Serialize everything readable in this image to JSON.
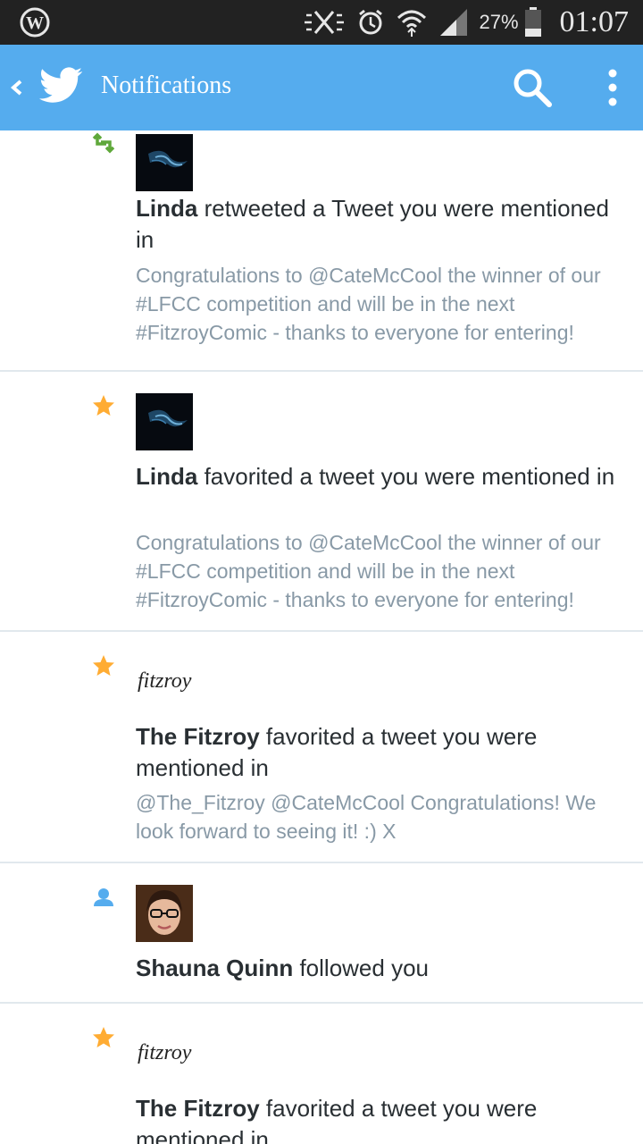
{
  "status_bar": {
    "battery": "27%",
    "time": "01:07",
    "icons": [
      "wordpress-icon",
      "mute-icon",
      "alarm-icon",
      "wifi-icon",
      "signal-icon",
      "battery-icon"
    ]
  },
  "app_bar": {
    "title": "Notifications",
    "bg_color": "#55acee",
    "icons": [
      "back-icon",
      "twitter-bird-icon",
      "search-icon",
      "overflow-menu-icon"
    ]
  },
  "notifications": [
    {
      "kind": "retweet",
      "user": "Linda",
      "action": " retweeted a Tweet you were mentioned in",
      "tweet": "Congratulations to @CateMcCool the winner of our #LFCC competition and will be in the next #FitzroyComic - thanks to everyone for entering!"
    },
    {
      "kind": "favorite",
      "user": "Linda",
      "action": " favorited a tweet you were mentioned in",
      "tweet": "Congratulations to @CateMcCool the winner of our #LFCC competition and will be in the next #FitzroyComic - thanks to everyone for entering!"
    },
    {
      "kind": "favorite",
      "user": "The Fitzroy",
      "action": " favorited a tweet you were mentioned in",
      "tweet": "@The_Fitzroy @CateMcCool Congratulations! We look forward to seeing it! :) X"
    },
    {
      "kind": "follow",
      "user": "Shauna Quinn",
      "action": " followed you",
      "tweet": ""
    },
    {
      "kind": "favorite",
      "user": "The Fitzroy",
      "action": " favorited a tweet you were mentioned in",
      "tweet": ""
    }
  ],
  "logo_text": "fitzroy",
  "colors": {
    "retweet": "#5fa83a",
    "favorite": "#ffac33",
    "follow": "#55acee",
    "secondary_text": "#8899a6",
    "primary_text": "#292f33"
  }
}
